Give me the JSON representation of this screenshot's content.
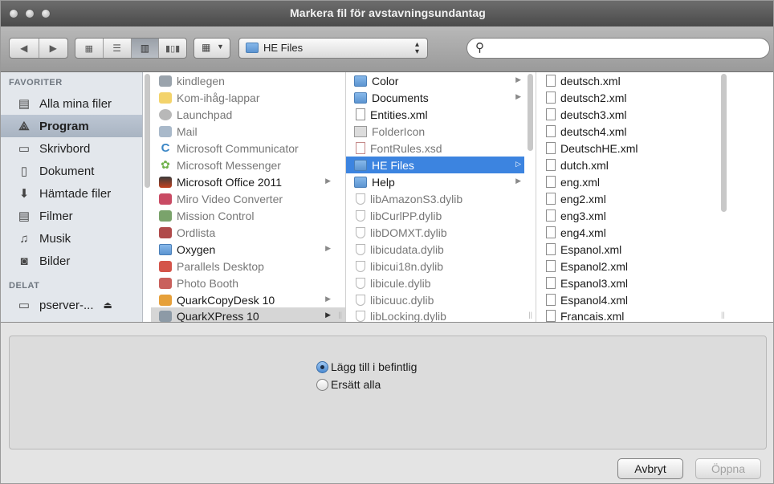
{
  "window": {
    "title": "Markera fil för avstavningsundantag"
  },
  "toolbar": {
    "back_icon": "chevron-left-icon",
    "forward_icon": "chevron-right-icon",
    "view_icons": [
      "icon-view-icon",
      "list-view-icon",
      "column-view-icon",
      "coverflow-view-icon"
    ],
    "arrange_icon": "arrange-grid-icon",
    "location": "HE Files",
    "search_placeholder": ""
  },
  "sidebar": {
    "favorites_header": "FAVORITER",
    "shared_header": "DELAT",
    "favorites": [
      {
        "label": "Alla mina filer",
        "icon": "all-files-icon",
        "selected": false
      },
      {
        "label": "Program",
        "icon": "applications-icon",
        "selected": true
      },
      {
        "label": "Skrivbord",
        "icon": "desktop-icon",
        "selected": false
      },
      {
        "label": "Dokument",
        "icon": "documents-icon",
        "selected": false
      },
      {
        "label": "Hämtade filer",
        "icon": "downloads-icon",
        "selected": false
      },
      {
        "label": "Filmer",
        "icon": "movies-icon",
        "selected": false
      },
      {
        "label": "Musik",
        "icon": "music-icon",
        "selected": false
      },
      {
        "label": "Bilder",
        "icon": "pictures-icon",
        "selected": false
      }
    ],
    "shared": [
      {
        "label": "pserver-...",
        "icon": "server-icon"
      }
    ]
  },
  "columns": {
    "applications": [
      {
        "name": "kindlegen",
        "dim": true,
        "arrow": false
      },
      {
        "name": "Kom-ihåg-lappar",
        "dim": true,
        "arrow": false
      },
      {
        "name": "Launchpad",
        "dim": true,
        "arrow": false
      },
      {
        "name": "Mail",
        "dim": true,
        "arrow": false
      },
      {
        "name": "Microsoft Communicator",
        "dim": true,
        "arrow": false
      },
      {
        "name": "Microsoft Messenger",
        "dim": true,
        "arrow": false
      },
      {
        "name": "Microsoft Office 2011",
        "dim": false,
        "arrow": true
      },
      {
        "name": "Miro Video Converter",
        "dim": true,
        "arrow": false
      },
      {
        "name": "Mission Control",
        "dim": true,
        "arrow": false
      },
      {
        "name": "Ordlista",
        "dim": true,
        "arrow": false
      },
      {
        "name": "Oxygen",
        "dim": false,
        "arrow": true
      },
      {
        "name": "Parallels Desktop",
        "dim": true,
        "arrow": false
      },
      {
        "name": "Photo Booth",
        "dim": true,
        "arrow": false
      },
      {
        "name": "QuarkCopyDesk 10",
        "dim": false,
        "arrow": true
      },
      {
        "name": "QuarkXPress 10",
        "dim": false,
        "arrow": true,
        "highlight": "grey"
      }
    ],
    "quark": [
      {
        "name": "Color",
        "type": "folder",
        "dim": false,
        "arrow": true
      },
      {
        "name": "Documents",
        "type": "folder",
        "dim": false,
        "arrow": true
      },
      {
        "name": "Entities.xml",
        "type": "doc",
        "dim": false,
        "arrow": false
      },
      {
        "name": "FolderIcon",
        "type": "img",
        "dim": true,
        "arrow": false
      },
      {
        "name": "FontRules.xsd",
        "type": "xsd",
        "dim": true,
        "arrow": false
      },
      {
        "name": "HE Files",
        "type": "folder",
        "dim": false,
        "arrow": true,
        "highlight": "blue"
      },
      {
        "name": "Help",
        "type": "folder",
        "dim": false,
        "arrow": true
      },
      {
        "name": "libAmazonS3.dylib",
        "type": "lib",
        "dim": true,
        "arrow": false
      },
      {
        "name": "libCurlPP.dylib",
        "type": "lib",
        "dim": true,
        "arrow": false
      },
      {
        "name": "libDOMXT.dylib",
        "type": "lib",
        "dim": true,
        "arrow": false
      },
      {
        "name": "libicudata.dylib",
        "type": "lib",
        "dim": true,
        "arrow": false
      },
      {
        "name": "libicui18n.dylib",
        "type": "lib",
        "dim": true,
        "arrow": false
      },
      {
        "name": "libicule.dylib",
        "type": "lib",
        "dim": true,
        "arrow": false
      },
      {
        "name": "libicuuc.dylib",
        "type": "lib",
        "dim": true,
        "arrow": false
      },
      {
        "name": "libLocking.dylib",
        "type": "lib",
        "dim": true,
        "arrow": false
      }
    ],
    "he_files": [
      "deutsch.xml",
      "deutsch2.xml",
      "deutsch3.xml",
      "deutsch4.xml",
      "DeutschHE.xml",
      "dutch.xml",
      "eng.xml",
      "eng2.xml",
      "eng3.xml",
      "eng4.xml",
      "Espanol.xml",
      "Espanol2.xml",
      "Espanol3.xml",
      "Espanol4.xml",
      "Francais.xml"
    ]
  },
  "options": {
    "append_label": "Lägg till i befintlig",
    "replace_label": "Ersätt alla",
    "selected": "append"
  },
  "buttons": {
    "cancel": "Avbryt",
    "open": "Öppna"
  }
}
